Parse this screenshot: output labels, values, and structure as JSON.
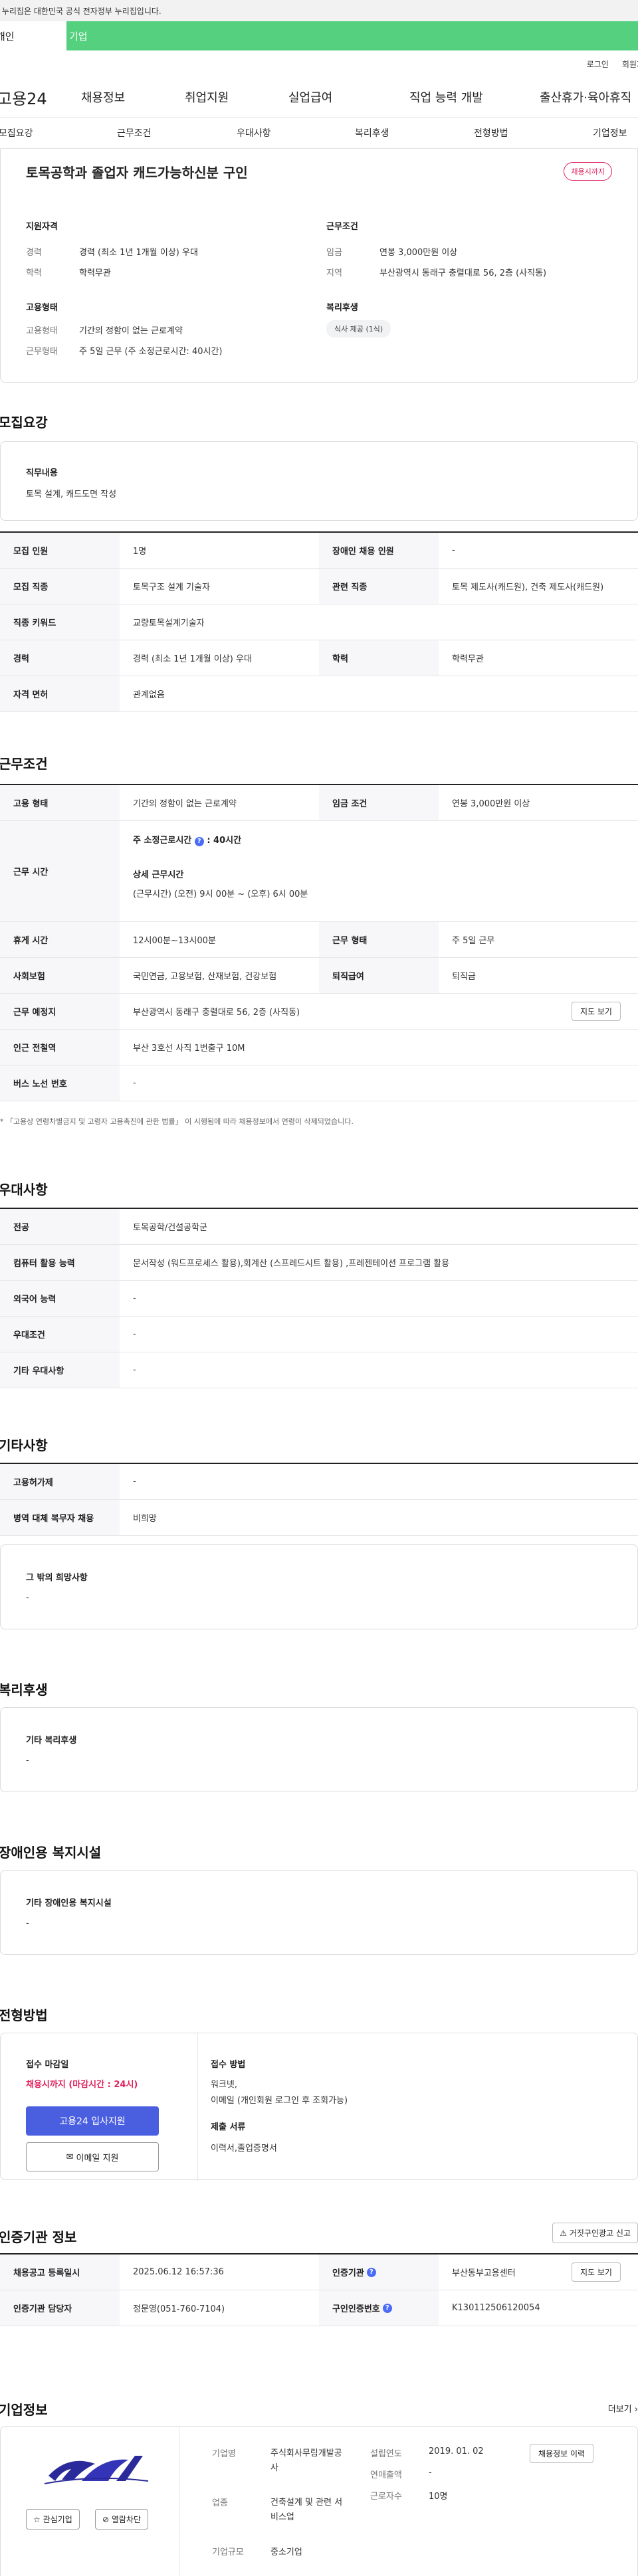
{
  "gov_banner": "이 누리집은 대한민국 공식 전자정부 누리집입니다.",
  "top_tabs": [
    "개인",
    "기업"
  ],
  "util": [
    "로그인",
    "회원가입"
  ],
  "logo": "고용24",
  "gnb": [
    "채용정보",
    "취업지원",
    "실업급여",
    "직업 능력 개발",
    "출산휴가·육아휴직"
  ],
  "lnb": [
    "모집요강",
    "근무조건",
    "우대사항",
    "복리후생",
    "전형방법",
    "기업정보"
  ],
  "summary": {
    "title": "토목공학과 졸업자 캐드가능하신분 구인",
    "badge": "채용시까지",
    "qual_title": "지원자격",
    "career_label": "경력",
    "career_val": "경력 (최소 1년 1개월 이상) 우대",
    "edu_label": "학력",
    "edu_val": "학력무관",
    "cond_title": "근무조건",
    "wage_label": "임금",
    "wage_val": "연봉 3,000만원 이상",
    "area_label": "지역",
    "area_val": "부산광역시 동래구 충렬대로 56, 2층 (사직동)",
    "emp_title": "고용형태",
    "emp_label": "고용형태",
    "emp_val": "기간의 정함이 없는 근로계약",
    "shift_label": "근무형태",
    "shift_val": "주 5일 근무 (주 소정근로시간: 40시간)",
    "welfare_title": "복리후생",
    "welfare_chip": "식사 제공 (1식)"
  },
  "recruit": {
    "title": "모집요강",
    "job_title": "직무내용",
    "job_text": "토목 설계, 캐드도면 작성",
    "rows": [
      [
        "모집 인원",
        "1명",
        "장애인 채용 인원",
        "-"
      ],
      [
        "모집 직종",
        "토목구조 설계 기술자",
        "관련 직종",
        "토목 제도사(캐드원), 건축 제도사(캐드원)"
      ],
      [
        "직종 키워드",
        "교량토목설계기술자"
      ],
      [
        "경력",
        "경력 (최소 1년 1개월 이상) 우대",
        "학력",
        "학력무관"
      ],
      [
        "자격 면허",
        "관계없음"
      ]
    ]
  },
  "conditions": {
    "title": "근무조건",
    "emp_type_label": "고용 형태",
    "emp_type_val": "기간의 정함이 없는 근로계약",
    "wage_label": "임금 조건",
    "wage_val": "연봉 3,000만원 이상",
    "hours_label": "근무 시간",
    "weekly_label": "주 소정근로시간",
    "weekly_val": ": 40시간",
    "detail_label": "상세 근무시간",
    "detail_val": "(근무시간) (오전) 9시 00분 ~ (오후) 6시 00분",
    "rest_label": "휴게 시간",
    "rest_val": "12시00분~13시00분",
    "shift_label": "근무 형태",
    "shift_val": "주 5일 근무",
    "ins_label": "사회보험",
    "ins_val": "국민연금, 고용보험, 산재보험, 건강보험",
    "sev_label": "퇴직급여",
    "sev_val": "퇴직금",
    "place_label": "근무 예정지",
    "place_val": "부산광역시 동래구 충렬대로 56, 2층 (사직동)",
    "map_btn": "지도 보기",
    "station_label": "인근 전철역",
    "station_val": "부산 3호선 사직 1번출구 10M",
    "bus_label": "버스 노선 번호",
    "bus_val": "-",
    "note": "* 「고용상 연령차별금지 및 고령자 고용촉진에 관한 법률」 이 시행됨에 따라 채용정보에서 연령이 삭제되었습니다."
  },
  "preference": {
    "title": "우대사항",
    "rows": [
      [
        "전공",
        "토목공학/건설공학군"
      ],
      [
        "컴퓨터 활용 능력",
        "문서작성 (워드프로세스 활용),회계산 (스프레드시트 활용) ,프레젠테이션 프로그램 활용"
      ],
      [
        "외국어 능력",
        "-"
      ],
      [
        "우대조건",
        "-"
      ],
      [
        "기타 우대사항",
        "-"
      ]
    ]
  },
  "etc": {
    "title": "기타사항",
    "rows": [
      [
        "고용허가제",
        "-"
      ],
      [
        "병역 대체 복무자 채용",
        "비희망"
      ]
    ],
    "other_title": "그 밖의 희망사항",
    "other_val": "-"
  },
  "welfare": {
    "title": "복리후생",
    "sub": "기타 복리후생",
    "val": "-"
  },
  "disability": {
    "title": "장애인용 복지시설",
    "sub": "기타 장애인용 복지시설",
    "val": "-"
  },
  "process": {
    "title": "전형방법",
    "deadline_label": "접수 마감일",
    "deadline_val": "채용시까지 (마감시간 : 24시)",
    "apply_btn": "고용24 입사지원",
    "email_btn": "이메일 지원",
    "method_label": "접수 방법",
    "method_val1": "워크넷,",
    "method_val2": "이메일 (개인회원 로그인 후 조회가능)",
    "docs_label": "제출 서류",
    "docs_val": "이력서,졸업증명서"
  },
  "agency": {
    "title": "인증기관 정보",
    "report_btn": "거짓구인광고 신고",
    "reg_label": "채용공고 등록일시",
    "reg_val": "2025.06.12 16:57:36",
    "org_label": "인증기관",
    "org_val": "부산동부고용센터",
    "map_btn": "지도 보기",
    "mgr_label": "인증기관 담당자",
    "mgr_val": "정문영(051-760-7104)",
    "no_label": "구인인증번호",
    "no_val": "K130112506120054"
  },
  "company": {
    "title": "기업정보",
    "more": "더보기",
    "fav_btn": "관심기업",
    "block_btn": "열람차단",
    "name_label": "기업명",
    "name_val": "주식회사무림개발공사",
    "ind_label": "업종",
    "ind_val": "건축설계 및 관련 서비스업",
    "size_label": "기업규모",
    "size_val": "중소기업",
    "est_label": "설립연도",
    "est_val": "2019. 01. 02",
    "sales_label": "연매출액",
    "sales_val": "-",
    "emp_label": "근로자수",
    "emp_val": "10명",
    "hist_btn": "채용정보 이력"
  }
}
